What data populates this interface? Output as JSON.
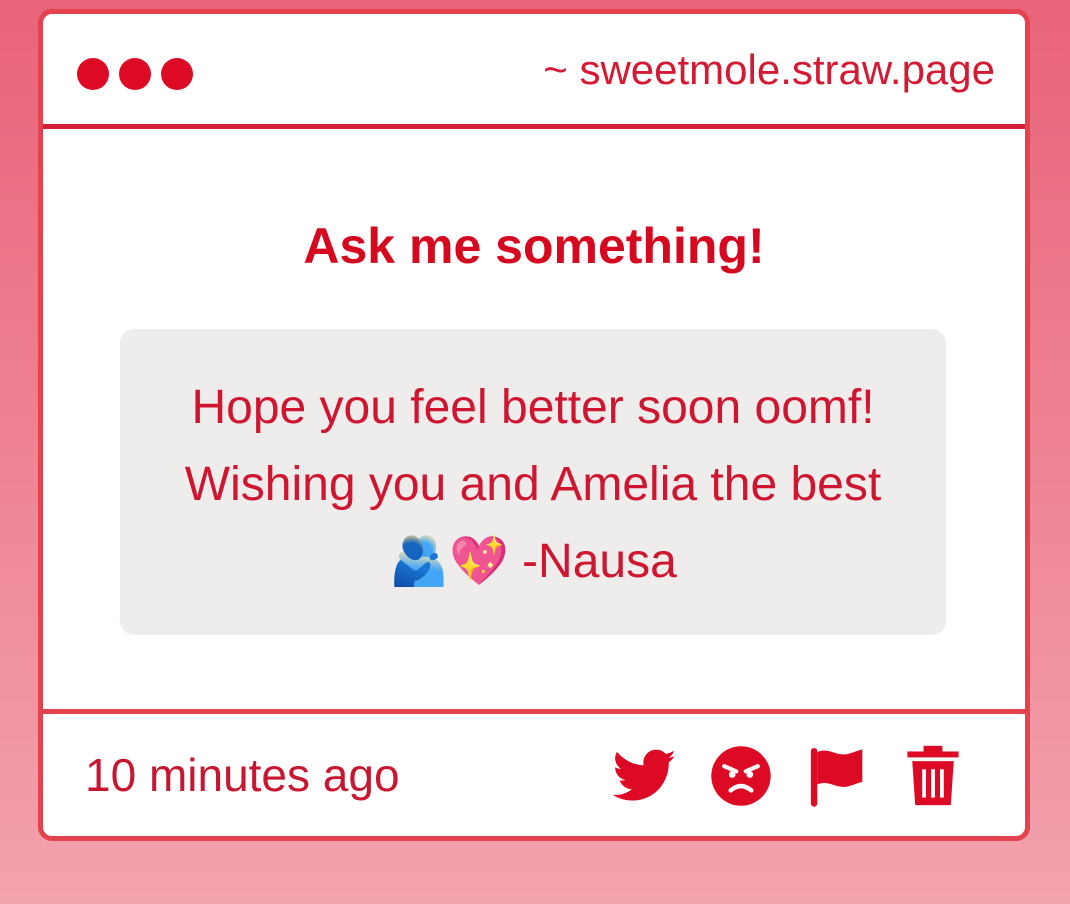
{
  "window": {
    "url": "~ sweetmole.straw.page"
  },
  "content": {
    "heading": "Ask me something!",
    "message": "Hope you feel better soon oomf! Wishing you and Amelia the best🫂💖 -Nausa"
  },
  "footer": {
    "timestamp": "10 minutes ago",
    "actions": [
      {
        "icon": "twitter-icon",
        "action": "share-twitter"
      },
      {
        "icon": "angry-face-icon",
        "action": "react-angry"
      },
      {
        "icon": "flag-icon",
        "action": "report"
      },
      {
        "icon": "trash-icon",
        "action": "delete"
      }
    ]
  },
  "colors": {
    "accent": "#dc0a25",
    "border": "#e3424f",
    "message_bg": "#efecec",
    "background_top": "#e9637a",
    "background_bottom": "#f3a3ae"
  }
}
